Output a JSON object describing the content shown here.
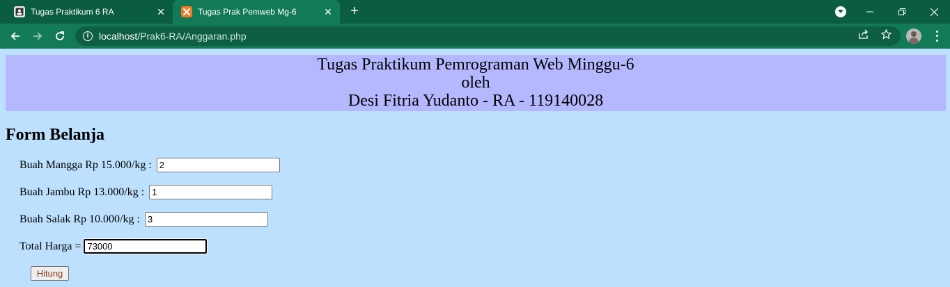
{
  "browser": {
    "tabs": [
      {
        "title": "Tugas Praktikum 6 RA",
        "favicon": "person-box-icon",
        "active": false
      },
      {
        "title": "Tugas Prak Pemweb Mg-6",
        "favicon": "xampp-icon",
        "active": true
      }
    ],
    "url_host": "localhost",
    "url_path": "/Prak6-RA/Anggaran.php",
    "accent": "#0a5c42"
  },
  "page": {
    "header": {
      "line1": "Tugas Praktikum Pemrograman Web Minggu-6",
      "line2": "oleh",
      "line3": "Desi Fitria Yudanto - RA - 119140028",
      "background": "#b5b8ff"
    },
    "form_title": "Form Belanja",
    "fields": [
      {
        "label": "Buah Mangga Rp 15.000/kg : ",
        "value": "2"
      },
      {
        "label": "Buah Jambu Rp 13.000/kg : ",
        "value": "1"
      },
      {
        "label": "Buah Salak Rp 10.000/kg : ",
        "value": "3"
      }
    ],
    "total": {
      "label": "Total Harga = ",
      "value": "73000"
    },
    "submit_label": "Hitung",
    "background": "#bde0fe"
  }
}
